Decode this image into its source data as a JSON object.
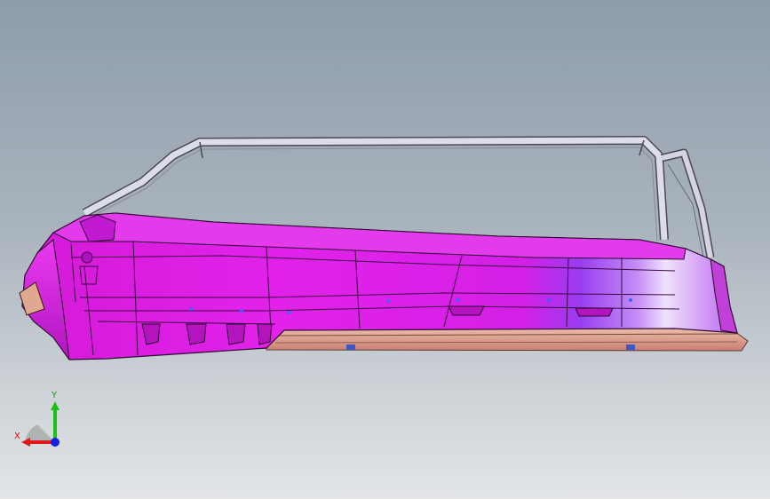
{
  "viewport": {
    "background_top": "#8e9cab",
    "background_bottom": "#e3e5e7"
  },
  "model": {
    "part_color": "#e020e8",
    "frame_color": "#d8d8e4",
    "sill_color": "#e6a898"
  },
  "triad": {
    "x_label": "X",
    "y_label": "Y",
    "x_color": "#e01818",
    "y_color": "#18c018",
    "z_color": "#1020e0"
  }
}
